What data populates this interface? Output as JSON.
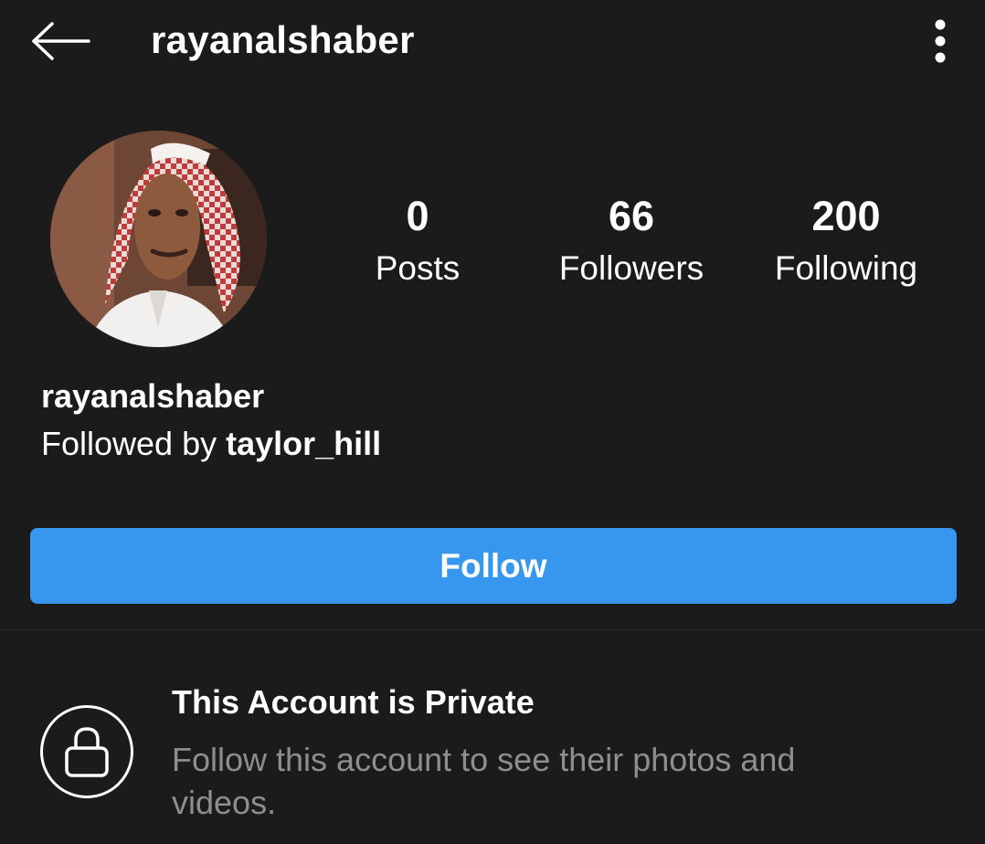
{
  "header": {
    "username": "rayanalshaber",
    "back_icon": "arrow-left-icon",
    "menu_icon": "more-vertical-icon"
  },
  "profile": {
    "avatar_alt": "profile photo",
    "name": "rayanalshaber",
    "followed_by_prefix": "Followed by ",
    "followed_by_user": "taylor_hill"
  },
  "stats": [
    {
      "value": "0",
      "label": "Posts"
    },
    {
      "value": "66",
      "label": "Followers"
    },
    {
      "value": "200",
      "label": "Following"
    }
  ],
  "actions": {
    "follow_label": "Follow"
  },
  "private_notice": {
    "icon": "lock-icon",
    "title": "This Account is Private",
    "description": "Follow this account to see their photos and videos."
  },
  "colors": {
    "background": "#1b1b1b",
    "follow_button": "#3797ef",
    "secondary_text": "#8e8e8e"
  }
}
